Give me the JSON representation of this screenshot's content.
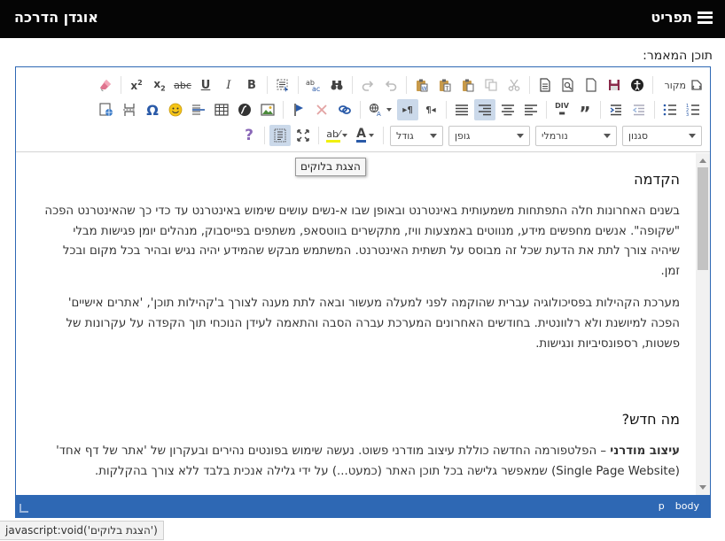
{
  "header": {
    "menu_label": "תפריט",
    "brand": "אוגדן הדרכה"
  },
  "form": {
    "field_label": "תוכן המאמר:"
  },
  "toolbar": {
    "row1_source_label": "מקור",
    "combos": {
      "style": "סגנון",
      "format": "נורמלי",
      "font": "גופן",
      "size": "גודל"
    },
    "tooltip": "הצגת בלוקים"
  },
  "content": {
    "heading1": "הקדמה",
    "para1": "בשנים האחרונות חלה התפתחות משמעותית באינטרנט ובאופן שבו א-נשים עושים שימוש באינטרנט עד כדי כך שהאינטרנט הפכה \"שקופה\". אנשים מחפשים מידע, מנווטים באמצעות וויז, מתקשרים בווטסאפ, משתפים בפייסבוק, מנהלים יומן פגישות מבלי שיהיה צורך לתת את הדעת שכל זה מבוסס על תשתית האינטרנט. המשתמש מבקש שהמידע יהיה נגיש ובהיר בכל מקום ובכל זמן.",
    "para2": "מערכת הקהילות בפסיכולוגיה עברית שהוקמה לפני למעלה מעשור ובאה לתת מענה לצורך ב'קהילות תוכן', 'אתרים אישיים' הפכה למיושנת ולא רלוונטית. בחודשים האחרונים המערכת עברה הסבה והתאמה לעידן הנוכחי תוך הקפדה על עקרונות של פשטות, רספונסיביות ונגישות.",
    "heading2": "מה חדש?",
    "para3_bold": "עיצוב מודרני",
    "para3_rest": " – הפלטפורמה החדשה כוללת עיצוב מודרני פשוט. נעשה שימוש בפונטים נהירים ובעקרון של 'אתר של דף אחד' (Single Page Website) שמאפשר גלישה בכל תוכן האתר (כמעט...) על ידי גלילה אנכית בלבד ללא צורך בהקלקות."
  },
  "statusbar": {
    "path_body": "body",
    "path_p": "p"
  },
  "browser_status": {
    "url": "javascript:void('הצגת בלוקים')"
  },
  "colors": {
    "topbar": "#050505",
    "editor_border": "#2e68b4",
    "active_button": "#cbd9ea"
  }
}
